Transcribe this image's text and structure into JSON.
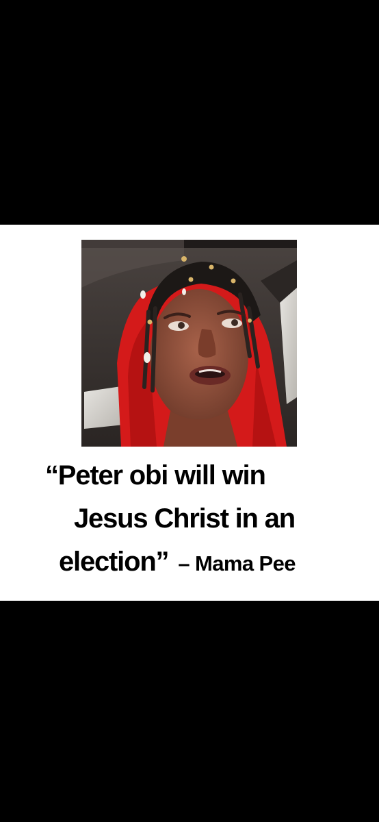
{
  "quote": {
    "line1": "“Peter obi will win",
    "line2": "Jesus Christ in an",
    "line3": "election”",
    "attribution": "– Mama Pee"
  },
  "colors": {
    "background": "#000000",
    "card": "#ffffff",
    "text": "#000000",
    "scarf": "#d41a1a"
  }
}
